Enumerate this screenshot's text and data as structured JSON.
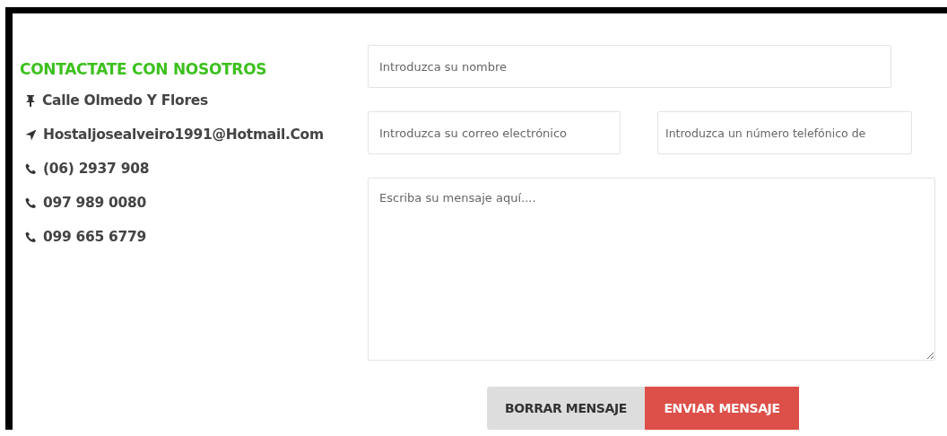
{
  "contact": {
    "heading": "CONTACTATE CON NOSOTROS",
    "items": [
      {
        "kind": "pin",
        "text": "Calle Olmedo Y Flores"
      },
      {
        "kind": "send",
        "text": "Hostaljosealveiro1991@Hotmail.Com"
      },
      {
        "kind": "phone",
        "text": "(06) 2937 908"
      },
      {
        "kind": "phone",
        "text": "097 989 0080"
      },
      {
        "kind": "phone",
        "text": "099 665 6779"
      }
    ]
  },
  "form": {
    "name": {
      "placeholder": "Introduzca su nombre"
    },
    "email": {
      "placeholder": "Introduzca su correo electrónico"
    },
    "phone": {
      "placeholder": "Introduzca un número telefónico de"
    },
    "message": {
      "placeholder": "Escriba su mensaje aquí...."
    },
    "buttons": [
      {
        "kind": "reset",
        "label": "BORRAR MENSAJE"
      },
      {
        "kind": "submit",
        "label": "ENVIAR MENSAJE"
      }
    ]
  }
}
